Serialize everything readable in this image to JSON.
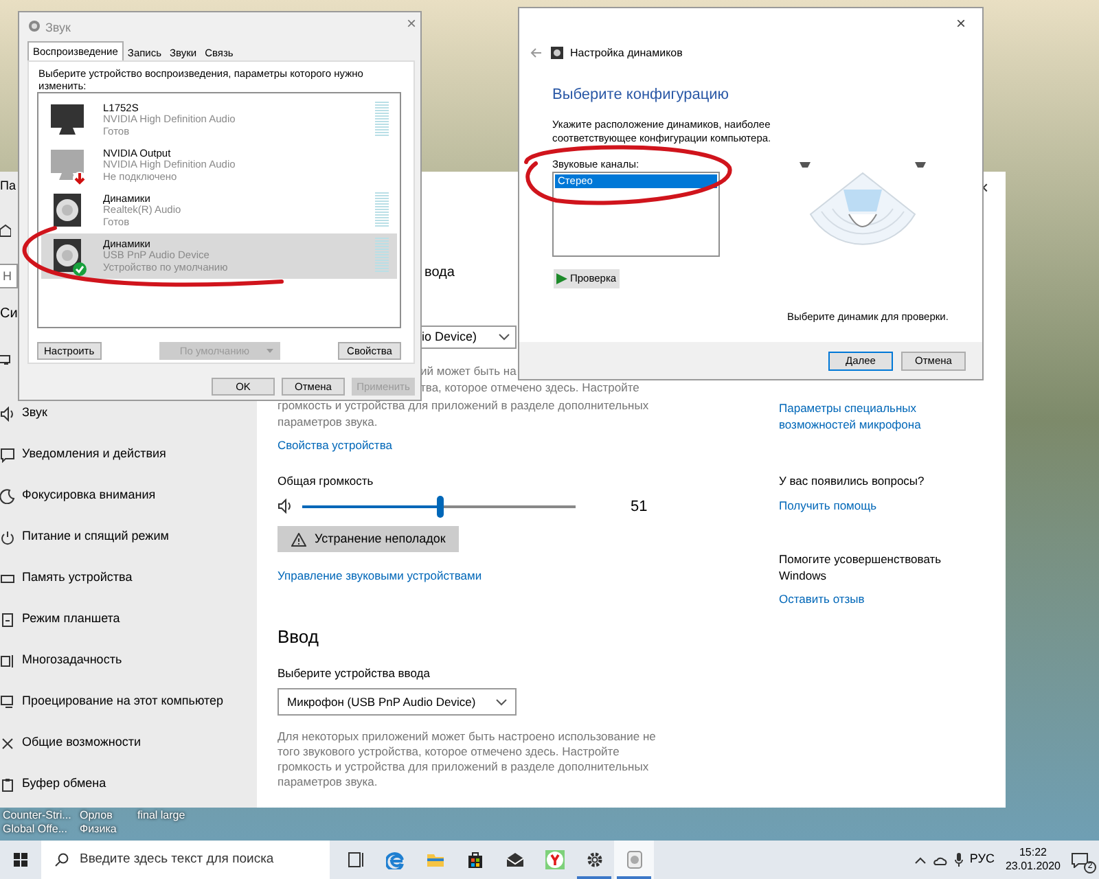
{
  "desktop": {
    "icons": [
      {
        "lines": [
          "Counter-Stri...",
          "Global Offe..."
        ]
      },
      {
        "lines": [
          "Орлов",
          "Физика"
        ]
      },
      {
        "lines": [
          "final large"
        ]
      }
    ]
  },
  "settings_window": {
    "title": "Па",
    "close_label": "×",
    "search_placeholder": "Н",
    "section_heading": "Си",
    "sidebar_items": [
      {
        "kind": "sound",
        "label": "Звук"
      },
      {
        "kind": "notifications",
        "label": "Уведомления и действия"
      },
      {
        "kind": "focus",
        "label": "Фокусировка внимания"
      },
      {
        "kind": "power",
        "label": "Питание и спящий режим"
      },
      {
        "kind": "storage",
        "label": "Память устройства"
      },
      {
        "kind": "tablet",
        "label": "Режим планшета"
      },
      {
        "kind": "multitask",
        "label": "Многозадачность"
      },
      {
        "kind": "project",
        "label": "Проецирование на этот компьютер"
      },
      {
        "kind": "shared",
        "label": "Общие возможности"
      },
      {
        "kind": "clipboard",
        "label": "Буфер обмена"
      }
    ],
    "output": {
      "heading_fragment": "вода",
      "device_fragment": "io Device)",
      "description_fragments": [
        "ий может быть на",
        "тва, которое отмечено здесь. Настройте",
        "громкость и устройства для приложений в разделе дополнительных",
        "параметров звука."
      ],
      "properties_link": "Свойства устройства",
      "volume_label": "Общая громкость",
      "volume": {
        "level": 0.51,
        "reading": "51"
      },
      "troubleshoot_button": "Устранение неполадок",
      "manage_link": "Управление звуковыми устройствами"
    },
    "input": {
      "heading": "Ввод",
      "label": "Выберите устройства ввода",
      "device": "Микрофон (USB PnP Audio Device)",
      "description": "Для некоторых приложений может быть настроено использование не того звукового устройства, которое отмечено здесь. Настройте громкость и устройства для приложений в разделе дополнительных параметров звука."
    },
    "side_column": {
      "accessibility_link": "Параметры специальных возможностей микрофона",
      "questions": "У вас появились вопросы?",
      "help_link": "Получить помощь",
      "improve": "Помогите усовершенствовать Windows",
      "feedback_link": "Оставить отзыв"
    }
  },
  "sound_dialog": {
    "title": "Звук",
    "close_label": "×",
    "tabs": [
      {
        "label": "Воспроизведение",
        "selected": true
      },
      {
        "label": "Запись",
        "selected": false
      },
      {
        "label": "Звуки",
        "selected": false
      },
      {
        "label": "Связь",
        "selected": false
      }
    ],
    "instruction": "Выберите устройство воспроизведения, параметры которого нужно изменить:",
    "devices": [
      {
        "kind": "monitor",
        "name": "L1752S",
        "driver": "NVIDIA High Definition Audio",
        "status": "Готов",
        "connected": true,
        "default": false,
        "meter": true,
        "selected": false
      },
      {
        "kind": "monitor",
        "name": "NVIDIA Output",
        "driver": "NVIDIA High Definition Audio",
        "status": "Не подключено",
        "connected": false,
        "default": false,
        "meter": false,
        "selected": false
      },
      {
        "kind": "speaker",
        "name": "Динамики",
        "driver": "Realtek(R) Audio",
        "status": "Готов",
        "connected": true,
        "default": false,
        "meter": true,
        "selected": false
      },
      {
        "kind": "speaker",
        "name": "Динамики",
        "driver": "USB PnP Audio Device",
        "status": "Устройство по умолчанию",
        "connected": true,
        "default": true,
        "meter": true,
        "selected": true
      }
    ],
    "buttons": [
      {
        "kind": "plain",
        "label": "Настроить",
        "disabled": false
      },
      {
        "kind": "split",
        "label": "По умолчанию",
        "disabled": true
      },
      {
        "kind": "plain",
        "label": "Свойства",
        "disabled": false
      }
    ],
    "footer_buttons": [
      {
        "label": "OK",
        "disabled": false
      },
      {
        "label": "Отмена",
        "disabled": false
      },
      {
        "label": "Применить",
        "disabled": true
      }
    ]
  },
  "speaker_dialog": {
    "title": "Настройка динамиков",
    "close_label": "×",
    "heading": "Выберите конфигурацию",
    "instruction": "Укажите расположение динамиков, наиболее соответствующее конфигурации компьютера.",
    "channels_label": "Звуковые каналы:",
    "channels": [
      {
        "label": "Стерео",
        "selected": true
      }
    ],
    "test_button": "Проверка",
    "hint": "Выберите динамик для проверки.",
    "buttons": [
      {
        "label": "Далее",
        "default": true
      },
      {
        "label": "Отмена",
        "default": false
      }
    ]
  },
  "taskbar": {
    "search_placeholder": "Введите здесь текст для поиска",
    "apps": [
      {
        "kind": "task-view",
        "running": false,
        "selected": false
      },
      {
        "kind": "edge",
        "running": false,
        "selected": false
      },
      {
        "kind": "explorer",
        "running": false,
        "selected": false
      },
      {
        "kind": "store",
        "running": false,
        "selected": false
      },
      {
        "kind": "mail",
        "running": false,
        "selected": false
      },
      {
        "kind": "yandex",
        "running": false,
        "selected": false
      },
      {
        "kind": "settings",
        "running": true,
        "selected": false
      },
      {
        "kind": "sound",
        "running": true,
        "selected": true
      }
    ],
    "language": "РУС",
    "time": "15:22",
    "date": "23.01.2020",
    "notification_count": "2"
  }
}
